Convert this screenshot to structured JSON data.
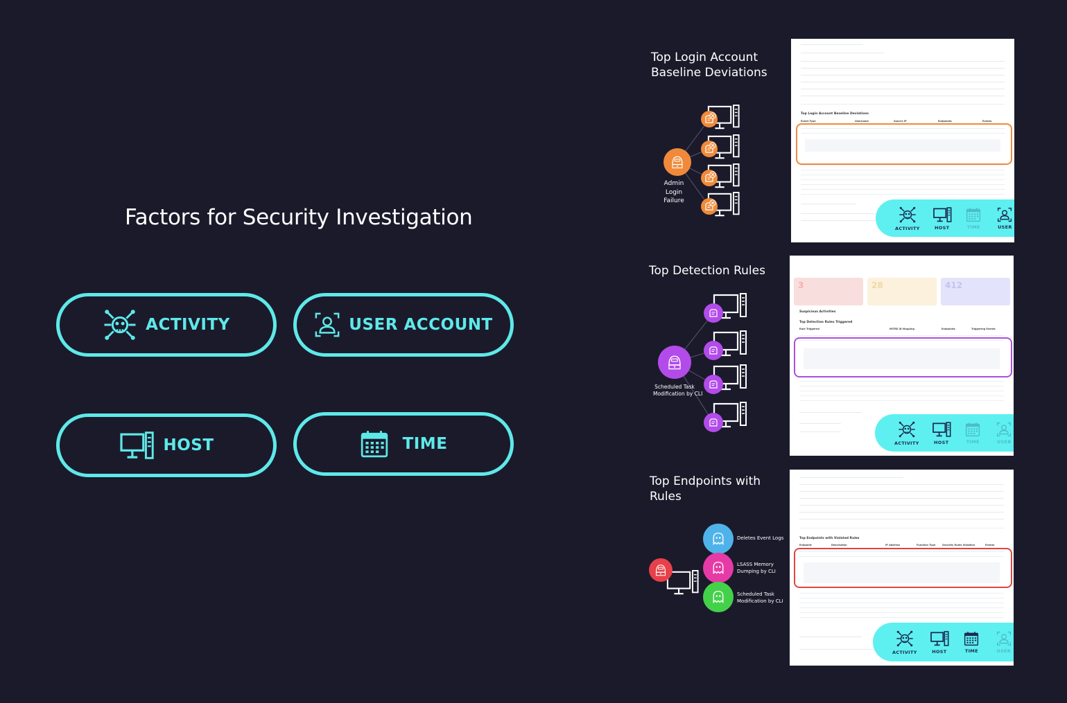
{
  "main_title": "Factors for Security Investigation",
  "factors": {
    "activity": "ACTIVITY",
    "user_account": "USER ACCOUNT",
    "host": "HOST",
    "time": "TIME"
  },
  "sections": [
    {
      "title_line1": "Top Login Account",
      "title_line2": "Baseline Deviations",
      "node_label_line1": "Admin",
      "node_label_line2": "Login",
      "node_label_line3": "Failure",
      "card": {
        "table_title": "Top Login Account Baseline Deviations",
        "columns": [
          "Event Type",
          "Username",
          "Source IP",
          "Endpoints",
          "Events"
        ],
        "dock": [
          "ACTIVITY",
          "HOST",
          "TIME",
          "USER"
        ]
      }
    },
    {
      "title": "Top Detection Rules",
      "node_label_line1": "Scheduled Task",
      "node_label_line2": "Modification by CLI",
      "card": {
        "tiles": [
          "3",
          "28",
          "412"
        ],
        "section_label": "Suspicious Activities",
        "table_title": "Top Detection Rules Triggered",
        "columns": [
          "Rule Triggered",
          "MITRE ID Mapping",
          "Endpoints",
          "Triggering Events"
        ],
        "dock": [
          "ACTIVITY",
          "HOST",
          "TIME",
          "USER"
        ]
      }
    },
    {
      "title_line1": "Top Endpoints with",
      "title_line2": "Rules",
      "ghosts": [
        {
          "line1": "Deletes Event Logs",
          "line2": "",
          "color": "#4fb3ea"
        },
        {
          "line1": "LSASS Memory",
          "line2": "Dumping by CLI",
          "color": "#e63aa6"
        },
        {
          "line1": "Scheduled Task",
          "line2": "Modification by CLI",
          "color": "#44d14a"
        }
      ],
      "card": {
        "table_title": "Top Endpoints with Violated Rules",
        "columns": [
          "Endpoint",
          "Description",
          "IP Address",
          "Function Type",
          "Security Rules Violation",
          "Events"
        ],
        "dock": [
          "ACTIVITY",
          "HOST",
          "TIME",
          "USER"
        ]
      }
    }
  ],
  "colors": {
    "background": "#1b1a2b",
    "accent": "#5ee9e9",
    "orange": "#f08a3a",
    "purple": "#b34bea",
    "red_node": "#e8404a",
    "highlight_orange": "#ef8a3c",
    "highlight_purple": "#a94ee0",
    "highlight_red": "#e0453e"
  },
  "icons": {
    "activity": "skull-crossbones-icon",
    "user_account": "user-scan-icon",
    "host": "desktop-server-icon",
    "time": "calendar-icon",
    "hacker": "hacker-icon",
    "ghost": "ghost-icon"
  }
}
